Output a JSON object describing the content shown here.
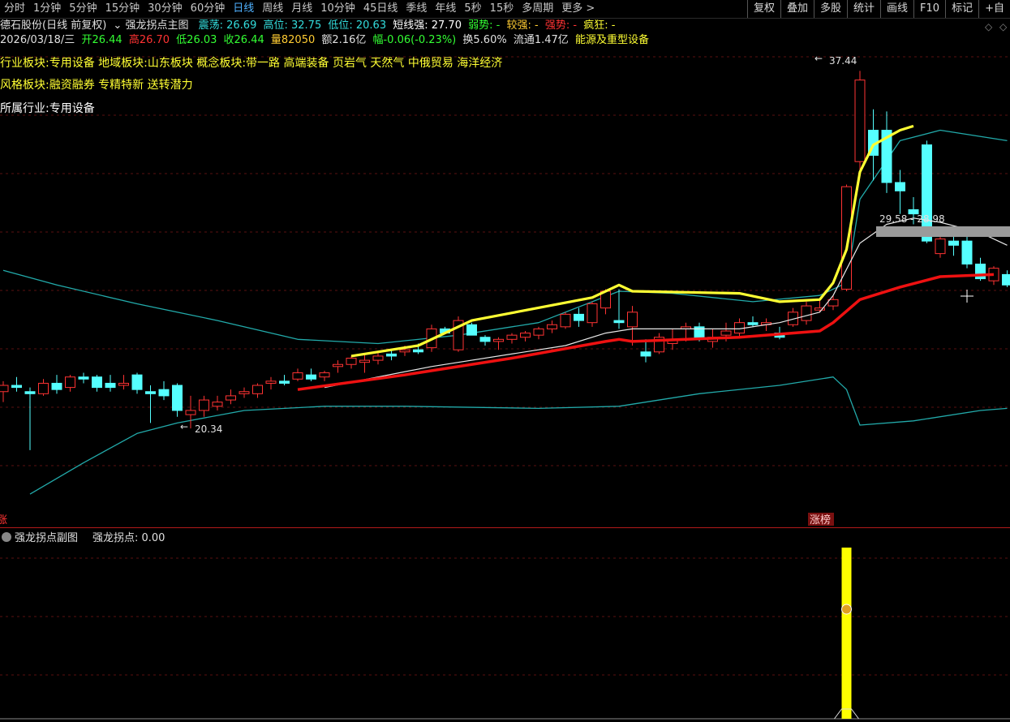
{
  "topbar": {
    "tabs": [
      "分时",
      "1分钟",
      "5分钟",
      "15分钟",
      "30分钟",
      "60分钟",
      "日线",
      "周线",
      "月线",
      "10分钟",
      "45日线",
      "季线",
      "年线",
      "5秒",
      "15秒",
      "多周期",
      "更多 >"
    ],
    "active": "日线",
    "right": [
      "复权",
      "叠加",
      "多股",
      "统计",
      "画线",
      "F10",
      "标记",
      "+自"
    ]
  },
  "header": {
    "stock": "德石股份(日线 前复权)",
    "indicator_name": "强龙拐点主图",
    "zhendang": "震荡: 26.69",
    "gaowei": "高位: 32.75",
    "diwei": "低位: 20.63",
    "duanxian": "短线强: 27.70",
    "ruoshi": "弱势: -",
    "jiaoqiang": "较强: -",
    "qiangshi": "强势: -",
    "fengkuang": "疯狂: -"
  },
  "quote": {
    "date": "2026/03/18/三",
    "open": "开26.44",
    "high": "高26.70",
    "low": "低26.03",
    "close": "收26.44",
    "vol": "量82050",
    "amount": "额2.16亿",
    "change": "幅-0.06(-0.23%)",
    "turnover": "换5.60%",
    "float": "流通1.47亿",
    "industry_tag": "能源及重型设备"
  },
  "sectors": {
    "line1": "行业板块:专用设备    地域板块:山东板块    概念板块:带一路 高端装备 页岩气 天然气 中俄贸易 海洋经济",
    "line2": "风格板块:融资融券 专精特新 送转潜力",
    "line3": "所属行业:专用设备"
  },
  "annotations": {
    "high_label": "37.44",
    "low_label": "20.34",
    "range_label": "29.58 - 28.98",
    "zhangbang": "涨榜",
    "left_marker": "涨"
  },
  "sub": {
    "title": "强龙拐点副图",
    "value": "强龙拐点: 0.00",
    "signal_icon": "money-bag-icon"
  },
  "colors": {
    "up": "#ff3333",
    "down": "#55ffff",
    "strong": "#ffff33",
    "support": "#ee1111",
    "band": "#22aaaa"
  },
  "chart_data": {
    "type": "candlestick",
    "ylim": [
      16.0,
      38.5
    ],
    "candles": [
      {
        "o": 22.1,
        "h": 22.6,
        "l": 21.6,
        "c": 22.4
      },
      {
        "o": 22.4,
        "h": 22.8,
        "l": 22.1,
        "c": 22.3
      },
      {
        "o": 22.1,
        "h": 22.3,
        "l": 19.3,
        "c": 22.0
      },
      {
        "o": 22.0,
        "h": 22.7,
        "l": 21.9,
        "c": 22.5
      },
      {
        "o": 22.5,
        "h": 22.9,
        "l": 22.0,
        "c": 22.2
      },
      {
        "o": 22.3,
        "h": 22.9,
        "l": 22.1,
        "c": 22.8
      },
      {
        "o": 22.8,
        "h": 23.0,
        "l": 22.5,
        "c": 22.7
      },
      {
        "o": 22.8,
        "h": 22.9,
        "l": 22.1,
        "c": 22.3
      },
      {
        "o": 22.5,
        "h": 22.9,
        "l": 22.1,
        "c": 22.3
      },
      {
        "o": 22.4,
        "h": 22.9,
        "l": 22.2,
        "c": 22.5
      },
      {
        "o": 22.9,
        "h": 23.0,
        "l": 22.0,
        "c": 22.2
      },
      {
        "o": 22.1,
        "h": 22.4,
        "l": 20.6,
        "c": 22.0
      },
      {
        "o": 22.2,
        "h": 22.6,
        "l": 21.7,
        "c": 21.9
      },
      {
        "o": 22.4,
        "h": 22.5,
        "l": 20.9,
        "c": 21.2
      },
      {
        "o": 21.0,
        "h": 21.9,
        "l": 20.34,
        "c": 21.2
      },
      {
        "o": 21.2,
        "h": 21.9,
        "l": 20.9,
        "c": 21.7
      },
      {
        "o": 21.4,
        "h": 21.9,
        "l": 21.2,
        "c": 21.6
      },
      {
        "o": 21.7,
        "h": 22.2,
        "l": 21.5,
        "c": 21.9
      },
      {
        "o": 22.0,
        "h": 22.3,
        "l": 21.8,
        "c": 22.1
      },
      {
        "o": 22.0,
        "h": 22.5,
        "l": 21.8,
        "c": 22.4
      },
      {
        "o": 22.5,
        "h": 22.8,
        "l": 22.2,
        "c": 22.6
      },
      {
        "o": 22.6,
        "h": 22.9,
        "l": 22.4,
        "c": 22.5
      },
      {
        "o": 22.7,
        "h": 23.2,
        "l": 22.6,
        "c": 23.0
      },
      {
        "o": 22.9,
        "h": 23.2,
        "l": 22.6,
        "c": 22.7
      },
      {
        "o": 22.8,
        "h": 23.1,
        "l": 22.6,
        "c": 23.0
      },
      {
        "o": 23.3,
        "h": 23.6,
        "l": 23.0,
        "c": 23.4
      },
      {
        "o": 23.4,
        "h": 23.8,
        "l": 23.2,
        "c": 23.7
      },
      {
        "o": 23.5,
        "h": 23.9,
        "l": 23.0,
        "c": 23.6
      },
      {
        "o": 23.6,
        "h": 24.0,
        "l": 23.4,
        "c": 23.8
      },
      {
        "o": 23.9,
        "h": 24.1,
        "l": 23.6,
        "c": 23.8
      },
      {
        "o": 24.0,
        "h": 24.3,
        "l": 23.8,
        "c": 24.1
      },
      {
        "o": 24.1,
        "h": 24.4,
        "l": 23.9,
        "c": 24.0
      },
      {
        "o": 24.2,
        "h": 25.3,
        "l": 24.0,
        "c": 25.1
      },
      {
        "o": 25.1,
        "h": 25.2,
        "l": 24.9,
        "c": 24.9
      },
      {
        "o": 24.1,
        "h": 25.7,
        "l": 24.0,
        "c": 25.5
      },
      {
        "o": 25.3,
        "h": 25.4,
        "l": 24.8,
        "c": 24.8
      },
      {
        "o": 24.7,
        "h": 24.8,
        "l": 24.3,
        "c": 24.5
      },
      {
        "o": 24.5,
        "h": 24.7,
        "l": 24.1,
        "c": 24.6
      },
      {
        "o": 24.6,
        "h": 24.9,
        "l": 24.4,
        "c": 24.8
      },
      {
        "o": 24.7,
        "h": 25.0,
        "l": 24.5,
        "c": 24.9
      },
      {
        "o": 24.8,
        "h": 25.2,
        "l": 24.6,
        "c": 25.1
      },
      {
        "o": 25.1,
        "h": 25.5,
        "l": 24.9,
        "c": 25.3
      },
      {
        "o": 25.2,
        "h": 25.9,
        "l": 25.1,
        "c": 25.8
      },
      {
        "o": 25.8,
        "h": 26.1,
        "l": 25.2,
        "c": 25.5
      },
      {
        "o": 25.4,
        "h": 26.4,
        "l": 25.2,
        "c": 26.3
      },
      {
        "o": 26.1,
        "h": 27.0,
        "l": 25.8,
        "c": 26.9
      },
      {
        "o": 25.5,
        "h": 27.0,
        "l": 25.1,
        "c": 25.4
      },
      {
        "o": 25.2,
        "h": 26.2,
        "l": 24.3,
        "c": 25.9
      },
      {
        "o": 24.0,
        "h": 24.6,
        "l": 23.5,
        "c": 23.8
      },
      {
        "o": 24.0,
        "h": 24.9,
        "l": 23.9,
        "c": 24.7
      },
      {
        "o": 24.4,
        "h": 25.1,
        "l": 24.1,
        "c": 24.6
      },
      {
        "o": 25.1,
        "h": 25.4,
        "l": 24.5,
        "c": 25.2
      },
      {
        "o": 25.2,
        "h": 25.4,
        "l": 24.5,
        "c": 24.6
      },
      {
        "o": 24.5,
        "h": 25.1,
        "l": 24.2,
        "c": 24.7
      },
      {
        "o": 24.8,
        "h": 25.4,
        "l": 24.5,
        "c": 25.0
      },
      {
        "o": 24.9,
        "h": 25.6,
        "l": 24.7,
        "c": 25.4
      },
      {
        "o": 25.4,
        "h": 25.7,
        "l": 25.2,
        "c": 25.3
      },
      {
        "o": 25.3,
        "h": 25.6,
        "l": 25.0,
        "c": 25.4
      },
      {
        "o": 24.9,
        "h": 25.2,
        "l": 24.6,
        "c": 24.7
      },
      {
        "o": 25.3,
        "h": 26.1,
        "l": 25.2,
        "c": 25.9
      },
      {
        "o": 25.5,
        "h": 26.4,
        "l": 25.3,
        "c": 26.2
      },
      {
        "o": 26.0,
        "h": 26.5,
        "l": 25.9,
        "c": 26.1
      },
      {
        "o": 26.2,
        "h": 26.7,
        "l": 26.0,
        "c": 26.5
      },
      {
        "o": 27.0,
        "h": 32.0,
        "l": 26.9,
        "c": 31.9
      },
      {
        "o": 33.1,
        "h": 37.44,
        "l": 32.6,
        "c": 37.0
      },
      {
        "o": 34.6,
        "h": 35.6,
        "l": 32.2,
        "c": 33.4
      },
      {
        "o": 34.6,
        "h": 35.5,
        "l": 31.6,
        "c": 32.1
      },
      {
        "o": 32.1,
        "h": 32.7,
        "l": 30.6,
        "c": 31.7
      },
      {
        "o": 30.8,
        "h": 31.4,
        "l": 30.1,
        "c": 30.6
      },
      {
        "o": 33.9,
        "h": 34.1,
        "l": 29.2,
        "c": 29.3
      },
      {
        "o": 28.7,
        "h": 29.8,
        "l": 28.5,
        "c": 29.4
      },
      {
        "o": 29.3,
        "h": 29.5,
        "l": 28.6,
        "c": 29.1
      },
      {
        "o": 29.3,
        "h": 29.5,
        "l": 28.0,
        "c": 28.2
      },
      {
        "o": 28.2,
        "h": 28.5,
        "l": 27.4,
        "c": 27.5
      },
      {
        "o": 27.4,
        "h": 28.1,
        "l": 27.2,
        "c": 28.0
      },
      {
        "o": 27.7,
        "h": 27.9,
        "l": 27.1,
        "c": 27.2
      }
    ],
    "support_line": [
      {
        "i": 22,
        "v": 22.2
      },
      {
        "i": 30,
        "v": 22.9
      },
      {
        "i": 38,
        "v": 23.7
      },
      {
        "i": 45,
        "v": 24.5
      },
      {
        "i": 46,
        "v": 24.6
      },
      {
        "i": 47,
        "v": 24.5
      },
      {
        "i": 55,
        "v": 24.7
      },
      {
        "i": 61,
        "v": 25.0
      },
      {
        "i": 62,
        "v": 25.4
      },
      {
        "i": 64,
        "v": 26.5
      },
      {
        "i": 67,
        "v": 27.1
      },
      {
        "i": 70,
        "v": 27.6
      },
      {
        "i": 74,
        "v": 27.7
      }
    ],
    "strong_line": [
      {
        "i": 26,
        "v": 23.8
      },
      {
        "i": 31,
        "v": 24.3
      },
      {
        "i": 35,
        "v": 25.5
      },
      {
        "i": 44,
        "v": 26.6
      },
      {
        "i": 46,
        "v": 27.2
      },
      {
        "i": 47,
        "v": 26.9
      },
      {
        "i": 55,
        "v": 26.8
      },
      {
        "i": 58,
        "v": 26.4
      },
      {
        "i": 61,
        "v": 26.5
      },
      {
        "i": 62,
        "v": 27.3
      },
      {
        "i": 63,
        "v": 28.9
      },
      {
        "i": 64,
        "v": 32.6
      },
      {
        "i": 65,
        "v": 33.9
      },
      {
        "i": 67,
        "v": 34.6
      },
      {
        "i": 68,
        "v": 34.8
      }
    ],
    "mid_line": [
      {
        "i": 24,
        "v": 22.3
      },
      {
        "i": 32,
        "v": 23.3
      },
      {
        "i": 42,
        "v": 24.3
      },
      {
        "i": 45,
        "v": 24.9
      },
      {
        "i": 47,
        "v": 25.1
      },
      {
        "i": 55,
        "v": 25.1
      },
      {
        "i": 58,
        "v": 25.4
      },
      {
        "i": 61,
        "v": 25.9
      },
      {
        "i": 62,
        "v": 26.7
      },
      {
        "i": 64,
        "v": 29.2
      },
      {
        "i": 66,
        "v": 30.1
      },
      {
        "i": 68,
        "v": 30.4
      },
      {
        "i": 70,
        "v": 30.2
      },
      {
        "i": 73,
        "v": 29.7
      },
      {
        "i": 75,
        "v": 29.1
      }
    ],
    "band_upper": [
      {
        "i": 0,
        "v": 27.9
      },
      {
        "i": 4,
        "v": 27.2
      },
      {
        "i": 10,
        "v": 26.3
      },
      {
        "i": 16,
        "v": 25.5
      },
      {
        "i": 22,
        "v": 24.6
      },
      {
        "i": 28,
        "v": 24.4
      },
      {
        "i": 34,
        "v": 24.8
      },
      {
        "i": 40,
        "v": 25.4
      },
      {
        "i": 46,
        "v": 26.9
      },
      {
        "i": 50,
        "v": 26.8
      },
      {
        "i": 56,
        "v": 26.4
      },
      {
        "i": 61,
        "v": 26.7
      },
      {
        "i": 63,
        "v": 27.3
      },
      {
        "i": 64,
        "v": 31.3
      },
      {
        "i": 67,
        "v": 34.1
      },
      {
        "i": 70,
        "v": 34.6
      },
      {
        "i": 75,
        "v": 34.1
      }
    ],
    "band_lower": [
      {
        "i": 2,
        "v": 17.2
      },
      {
        "i": 6,
        "v": 18.7
      },
      {
        "i": 10,
        "v": 20.1
      },
      {
        "i": 13,
        "v": 20.6
      },
      {
        "i": 18,
        "v": 21.2
      },
      {
        "i": 24,
        "v": 21.4
      },
      {
        "i": 30,
        "v": 21.4
      },
      {
        "i": 40,
        "v": 21.3
      },
      {
        "i": 46,
        "v": 21.4
      },
      {
        "i": 52,
        "v": 22.0
      },
      {
        "i": 58,
        "v": 22.4
      },
      {
        "i": 62,
        "v": 22.8
      },
      {
        "i": 63,
        "v": 22.2
      },
      {
        "i": 64,
        "v": 20.5
      },
      {
        "i": 68,
        "v": 20.7
      },
      {
        "i": 73,
        "v": 21.2
      },
      {
        "i": 75,
        "v": 21.3
      }
    ],
    "signal": {
      "i": 63,
      "value": 1
    }
  }
}
